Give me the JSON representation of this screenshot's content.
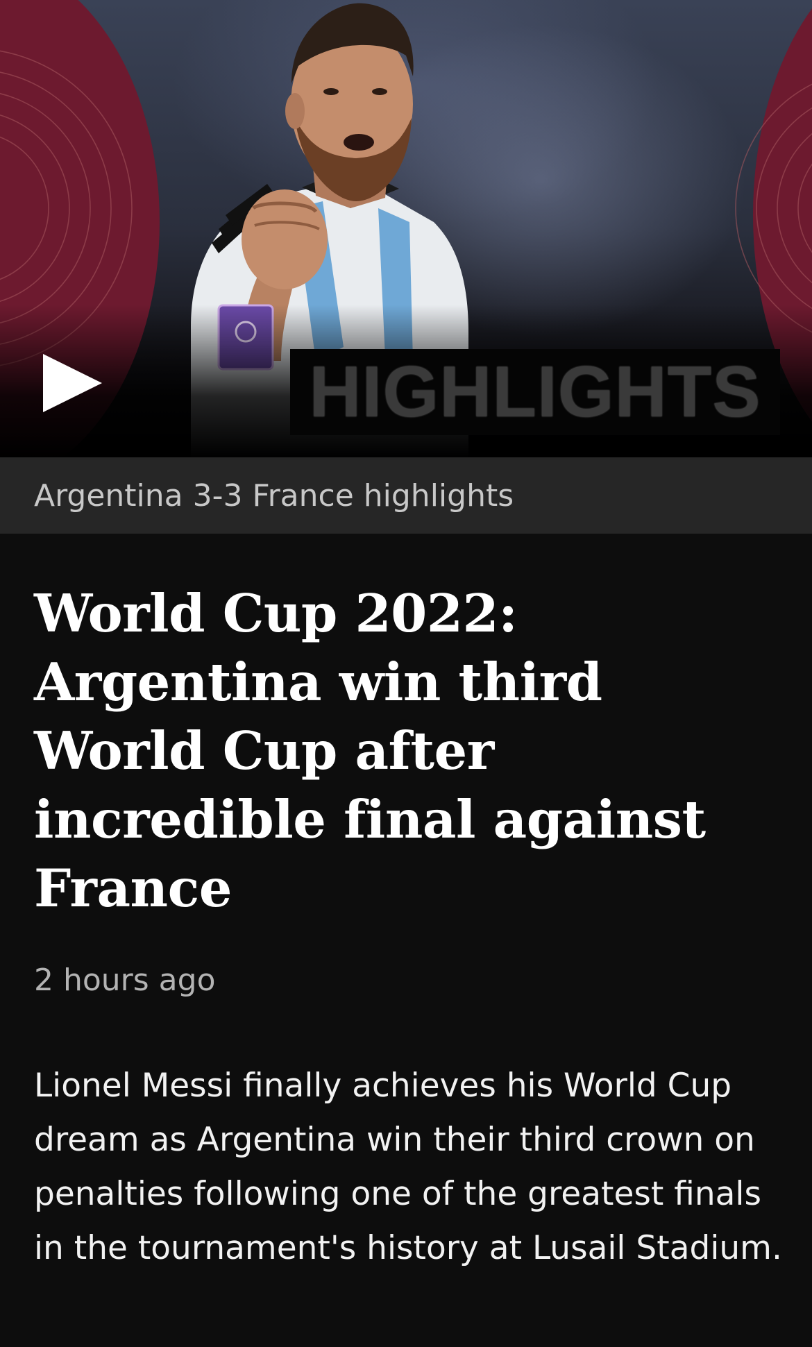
{
  "video": {
    "overlay_title": "HIGHLIGHTS",
    "caption": "Argentina 3-3 France highlights",
    "play_icon": "play-icon",
    "colors": {
      "maroon": "#6d1a2f",
      "caption_bar": "#262626"
    }
  },
  "article": {
    "headline": "World Cup 2022: Argentina win third World Cup after incredible final against France",
    "timestamp": "2 hours ago",
    "summary": "Lionel Messi finally achieves his World Cup dream as Argentina win their third crown on penalties following one of the greatest finals in the tournament's history at Lusail Stadium."
  }
}
